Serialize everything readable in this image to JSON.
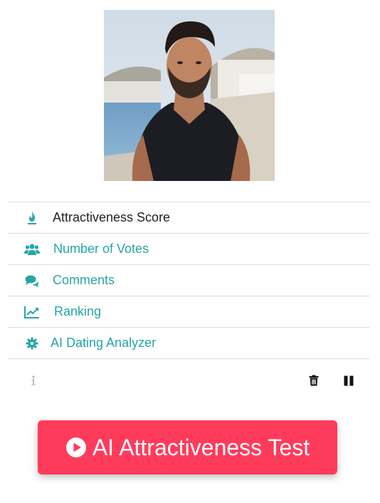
{
  "profile": {
    "photo_alt": "Profile photo"
  },
  "menu": {
    "items": [
      {
        "label": "Attractiveness Score",
        "icon": "flame-icon"
      },
      {
        "label": "Number of Votes",
        "icon": "users-icon"
      },
      {
        "label": "Comments",
        "icon": "comments-icon"
      },
      {
        "label": "Ranking",
        "icon": "chart-line-icon"
      },
      {
        "label": "AI Dating Analyzer",
        "icon": "gear-icon"
      }
    ]
  },
  "toolbar": {
    "info_icon": "info-icon",
    "delete_icon": "trash-icon",
    "pause_icon": "pause-icon"
  },
  "cta": {
    "label": "AI Attractiveness Test",
    "icon": "play-circle-icon"
  },
  "colors": {
    "accent": "#26a5a5",
    "cta": "#ff3b5c",
    "divider": "#dcdcdc"
  }
}
